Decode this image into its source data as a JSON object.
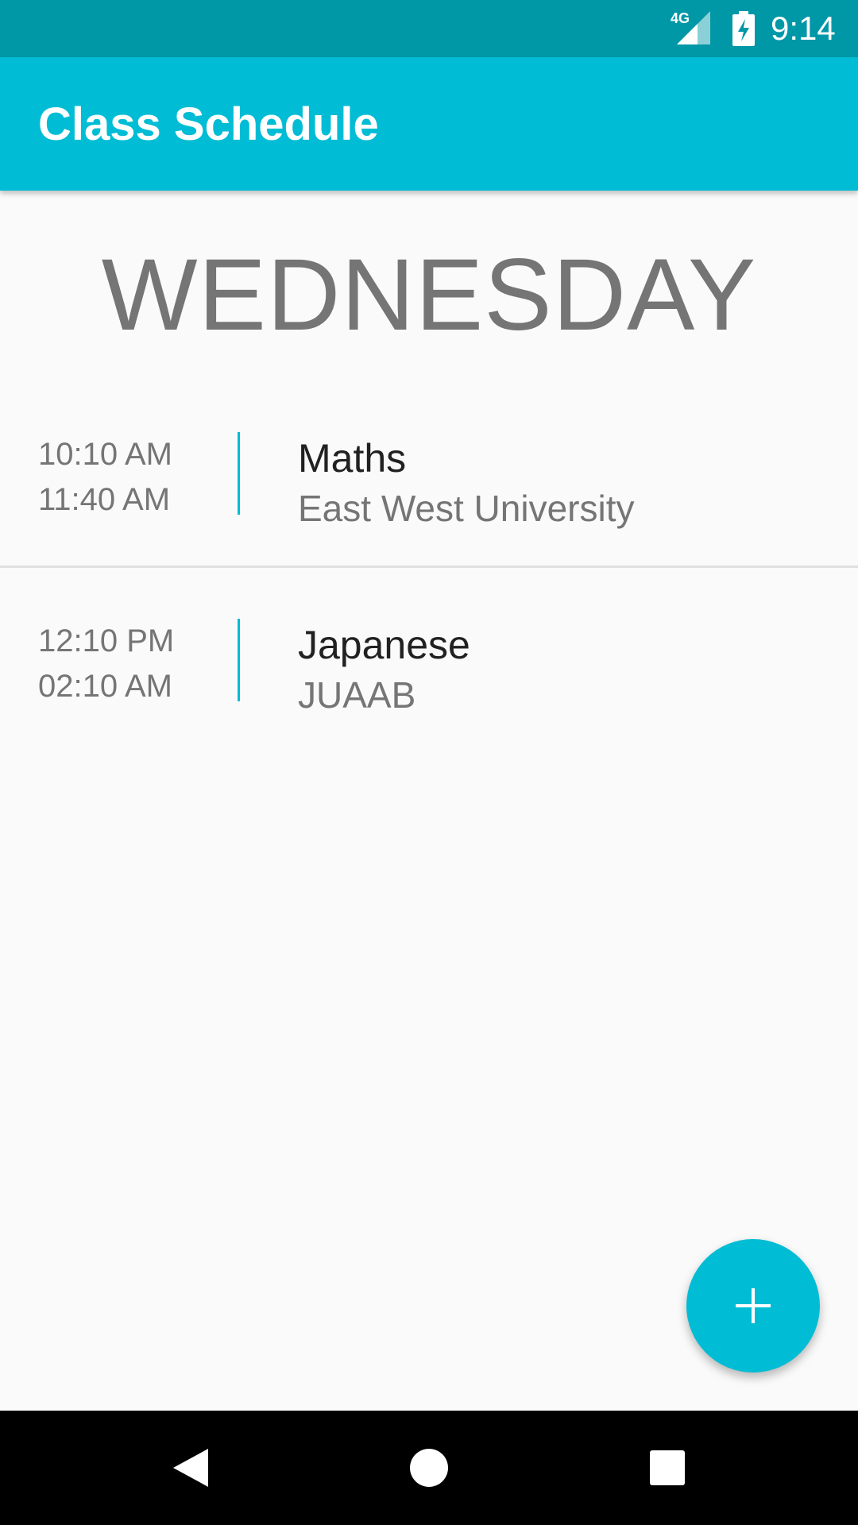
{
  "status_bar": {
    "network_label": "4G",
    "time": "9:14",
    "network_icon": "cellular-signal-icon",
    "battery_icon": "battery-charging-icon"
  },
  "app_bar": {
    "title": "Class Schedule"
  },
  "schedule": {
    "day": "WEDNESDAY",
    "classes": [
      {
        "start_time": "10:10 AM",
        "end_time": "11:40 AM",
        "name": "Maths",
        "location": "East West University"
      },
      {
        "start_time": "12:10 PM",
        "end_time": "02:10 AM",
        "name": "Japanese",
        "location": "JUAAB"
      }
    ]
  },
  "fab": {
    "icon": "plus-icon"
  },
  "nav_bar": {
    "back_icon": "back-triangle-icon",
    "home_icon": "home-circle-icon",
    "recents_icon": "recents-square-icon"
  },
  "colors": {
    "primary": "#00bcd4",
    "primary_dark": "#0097a7",
    "background": "#fafafa",
    "secondary_text": "#757575",
    "primary_text": "#212121"
  }
}
